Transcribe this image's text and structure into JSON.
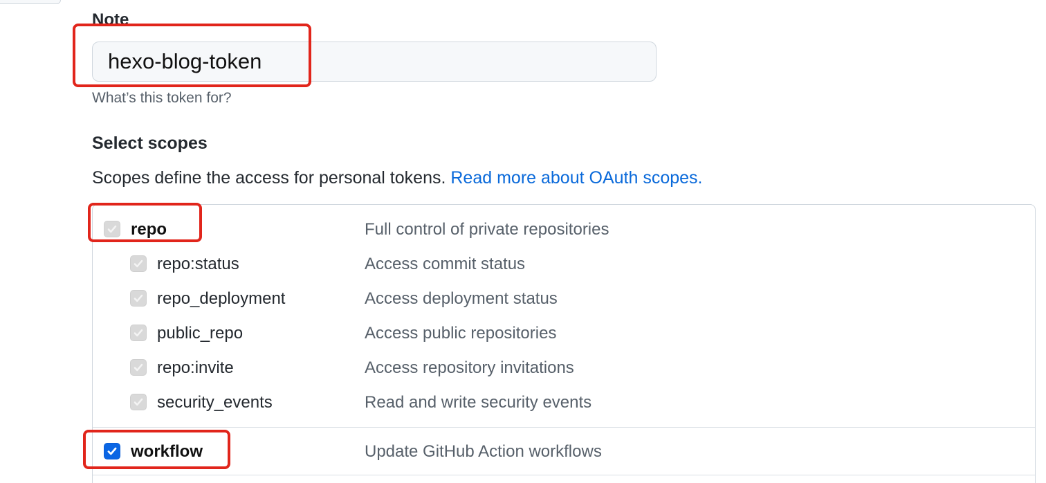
{
  "note": {
    "label": "Note",
    "value": "hexo-blog-token",
    "hint": "What’s this token for?"
  },
  "scopes": {
    "heading": "Select scopes",
    "description": "Scopes define the access for personal tokens.",
    "link_text": "Read more about OAuth scopes.",
    "items": [
      {
        "name": "repo",
        "description": "Full control of private repositories",
        "checked": true,
        "disabled": true,
        "level": "parent"
      },
      {
        "name": "repo:status",
        "description": "Access commit status",
        "checked": true,
        "disabled": true,
        "level": "child"
      },
      {
        "name": "repo_deployment",
        "description": "Access deployment status",
        "checked": true,
        "disabled": true,
        "level": "child"
      },
      {
        "name": "public_repo",
        "description": "Access public repositories",
        "checked": true,
        "disabled": true,
        "level": "child"
      },
      {
        "name": "repo:invite",
        "description": "Access repository invitations",
        "checked": true,
        "disabled": true,
        "level": "child"
      },
      {
        "name": "security_events",
        "description": "Read and write security events",
        "checked": true,
        "disabled": true,
        "level": "child"
      },
      {
        "name": "workflow",
        "description": "Update GitHub Action workflows",
        "checked": true,
        "disabled": false,
        "level": "parent"
      }
    ]
  },
  "colors": {
    "link": "#0969da",
    "checkbox_checked": "#0b66e4",
    "checkbox_disabled": "#d9d9d9",
    "highlight": "#e1251b"
  },
  "icons": {
    "checkmark": "checkmark-icon"
  }
}
